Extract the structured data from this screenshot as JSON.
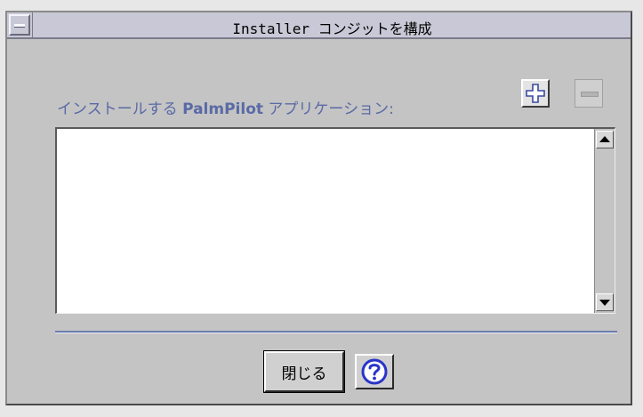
{
  "window": {
    "title": "Installer コンジットを構成"
  },
  "main": {
    "label_prefix": "インストールする ",
    "label_brand": "PalmPilot",
    "label_suffix": " アプリケーション:",
    "add_icon": "plus-icon",
    "remove_icon": "minus-icon",
    "remove_enabled": false,
    "app_list": []
  },
  "footer": {
    "close_label": "閉じる",
    "help_icon": "question-icon"
  },
  "colors": {
    "accent": "#5a6aa6",
    "help_icon": "#2a34c8"
  }
}
